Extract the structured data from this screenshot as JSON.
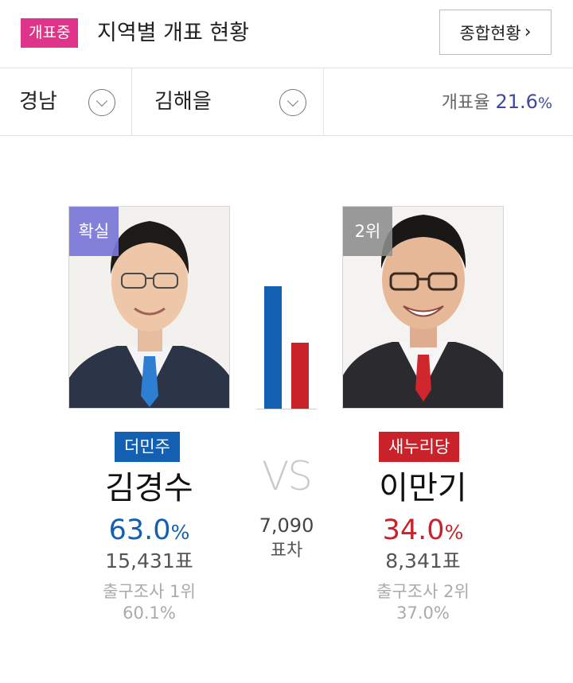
{
  "header": {
    "live_badge": "개표중",
    "title": "지역별 개표 현황",
    "summary_button": "종합현황",
    "summary_chevron": "›"
  },
  "selectors": {
    "region": "경남",
    "district": "김해을",
    "rate_label": "개표율",
    "rate_value": "21.6",
    "rate_unit": "%"
  },
  "candidates": [
    {
      "rank_badge": "확실",
      "party": "더민주",
      "name": "김경수",
      "percent": "63.0",
      "percent_unit": "%",
      "votes": "15,431표",
      "exit_poll_rank": "출구조사 1위",
      "exit_poll_pct": "60.1%",
      "color": "#1360b2",
      "bar_share": 0.63
    },
    {
      "rank_badge": "2위",
      "party": "새누리당",
      "name": "이만기",
      "percent": "34.0",
      "percent_unit": "%",
      "votes": "8,341표",
      "exit_poll_rank": "출구조사 2위",
      "exit_poll_pct": "37.0%",
      "color": "#c9222a",
      "bar_share": 0.34
    }
  ],
  "comparison": {
    "vs": "VS",
    "margin_value": "7,090",
    "margin_label": "표차"
  }
}
